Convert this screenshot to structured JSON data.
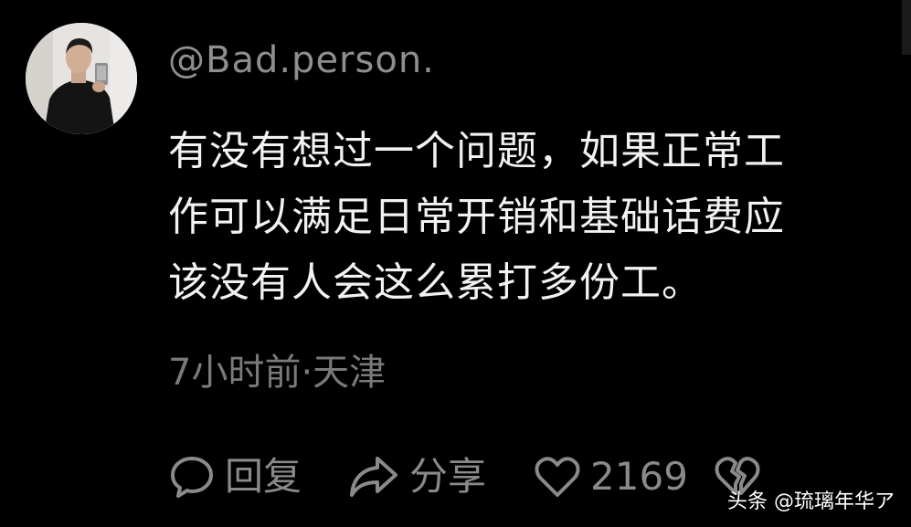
{
  "user": {
    "name": "@Bad.person."
  },
  "comment": {
    "lines": [
      "有没有想过一个问题，如果正常工",
      "作可以满足日常开销和基础话费应",
      "该没有人会这么累打多份工。"
    ]
  },
  "meta": {
    "time_location": "7小时前·天津"
  },
  "actions": {
    "reply_label": "回复",
    "share_label": "分享",
    "like_count": "2169"
  },
  "watermark": {
    "text": "头条 @琉璃年华ア"
  },
  "icons": {
    "reply": "comment-bubble-icon",
    "share": "share-arrow-icon",
    "like": "heart-icon",
    "dislike": "broken-heart-icon"
  },
  "colors": {
    "background": "#000000",
    "text": "#f2f2f2",
    "muted": "#8a8a8a"
  }
}
